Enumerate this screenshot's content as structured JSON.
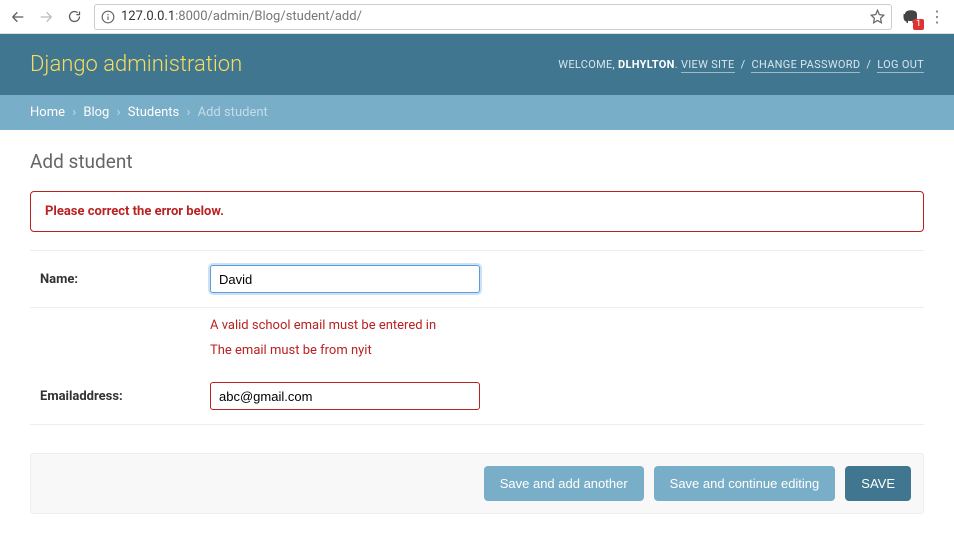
{
  "browser": {
    "url_host": "127.0.0.1",
    "url_port_path": ":8000/admin/Blog/student/add/",
    "ext_badge": "1"
  },
  "header": {
    "branding": "Django administration",
    "welcome": "WELCOME,",
    "username": "DLHYLTON",
    "view_site": "VIEW SITE",
    "change_password": "CHANGE PASSWORD",
    "log_out": "LOG OUT"
  },
  "breadcrumbs": {
    "home": "Home",
    "app": "Blog",
    "model": "Students",
    "action": "Add student"
  },
  "page": {
    "title": "Add student",
    "errornote": "Please correct the error below."
  },
  "form": {
    "name": {
      "label": "Name:",
      "value": "David"
    },
    "email": {
      "label": "Emailaddress:",
      "value": "abc@gmail.com",
      "errors": [
        "A valid school email must be entered in",
        "The email must be from nyit"
      ]
    }
  },
  "buttons": {
    "save_add": "Save and add another",
    "save_continue": "Save and continue editing",
    "save": "SAVE"
  }
}
